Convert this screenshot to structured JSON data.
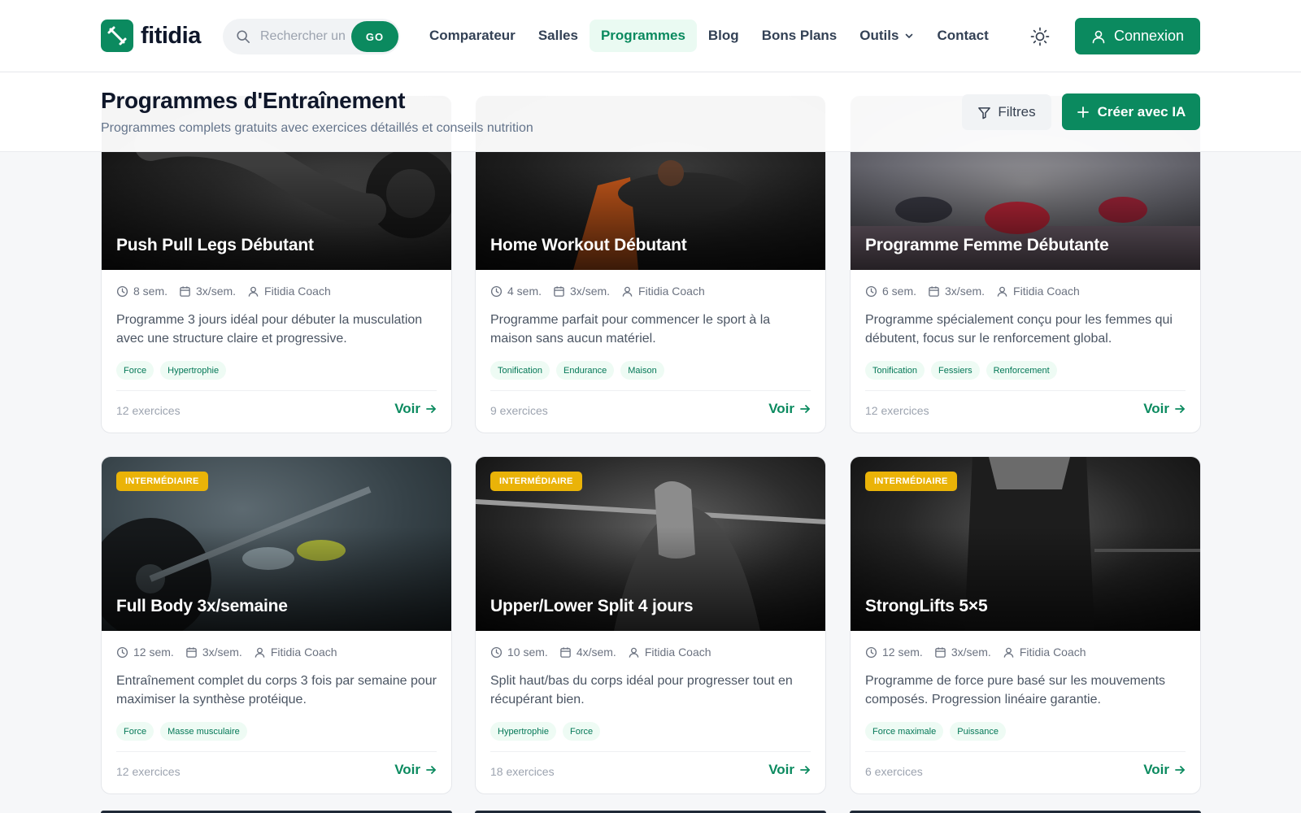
{
  "brand": {
    "name": "fitidia"
  },
  "search": {
    "placeholder": "Rechercher un",
    "go_label": "GO"
  },
  "nav": {
    "items": [
      {
        "label": "Comparateur"
      },
      {
        "label": "Salles"
      },
      {
        "label": "Programmes"
      },
      {
        "label": "Blog"
      },
      {
        "label": "Bons Plans"
      },
      {
        "label": "Outils"
      },
      {
        "label": "Contact"
      }
    ],
    "login_label": "Connexion"
  },
  "page": {
    "title": "Programmes d'Entraînement",
    "subtitle": "Programmes complets gratuits avec exercices détaillés et conseils nutrition",
    "filters_label": "Filtres",
    "create_label": "Créer avec IA"
  },
  "cards": [
    {
      "title": "Push Pull Legs Débutant",
      "badge": "",
      "duration": "8 sem.",
      "frequency": "3x/sem.",
      "coach": "Fitidia Coach",
      "description": "Programme 3 jours idéal pour débuter la musculation avec une structure claire et progressive.",
      "tags": [
        "Force",
        "Hypertrophie"
      ],
      "exercises": "12 exercices",
      "cta": "Voir"
    },
    {
      "title": "Home Workout Débutant",
      "badge": "",
      "duration": "4 sem.",
      "frequency": "3x/sem.",
      "coach": "Fitidia Coach",
      "description": "Programme parfait pour commencer le sport à la maison sans aucun matériel.",
      "tags": [
        "Tonification",
        "Endurance",
        "Maison"
      ],
      "exercises": "9 exercices",
      "cta": "Voir"
    },
    {
      "title": "Programme Femme Débutante",
      "badge": "",
      "duration": "6 sem.",
      "frequency": "3x/sem.",
      "coach": "Fitidia Coach",
      "description": "Programme spécialement conçu pour les femmes qui débutent, focus sur le renforcement global.",
      "tags": [
        "Tonification",
        "Fessiers",
        "Renforcement"
      ],
      "exercises": "12 exercices",
      "cta": "Voir"
    },
    {
      "title": "Full Body 3x/semaine",
      "badge": "INTERMÉDIAIRE",
      "duration": "12 sem.",
      "frequency": "3x/sem.",
      "coach": "Fitidia Coach",
      "description": "Entraînement complet du corps 3 fois par semaine pour maximiser la synthèse protéique.",
      "tags": [
        "Force",
        "Masse musculaire"
      ],
      "exercises": "12 exercices",
      "cta": "Voir"
    },
    {
      "title": "Upper/Lower Split 4 jours",
      "badge": "INTERMÉDIAIRE",
      "duration": "10 sem.",
      "frequency": "4x/sem.",
      "coach": "Fitidia Coach",
      "description": "Split haut/bas du corps idéal pour progresser tout en récupérant bien.",
      "tags": [
        "Hypertrophie",
        "Force"
      ],
      "exercises": "18 exercices",
      "cta": "Voir"
    },
    {
      "title": "StrongLifts 5×5",
      "badge": "INTERMÉDIAIRE",
      "duration": "12 sem.",
      "frequency": "3x/sem.",
      "coach": "Fitidia Coach",
      "description": "Programme de force pure basé sur les mouvements composés. Progression linéaire garantie.",
      "tags": [
        "Force maximale",
        "Puissance"
      ],
      "exercises": "6 exercices",
      "cta": "Voir"
    }
  ],
  "colors": {
    "accent": "#0b8a5f",
    "badge": "#eab308",
    "tag_bg": "#eefbf4",
    "tag_text": "#047857"
  }
}
